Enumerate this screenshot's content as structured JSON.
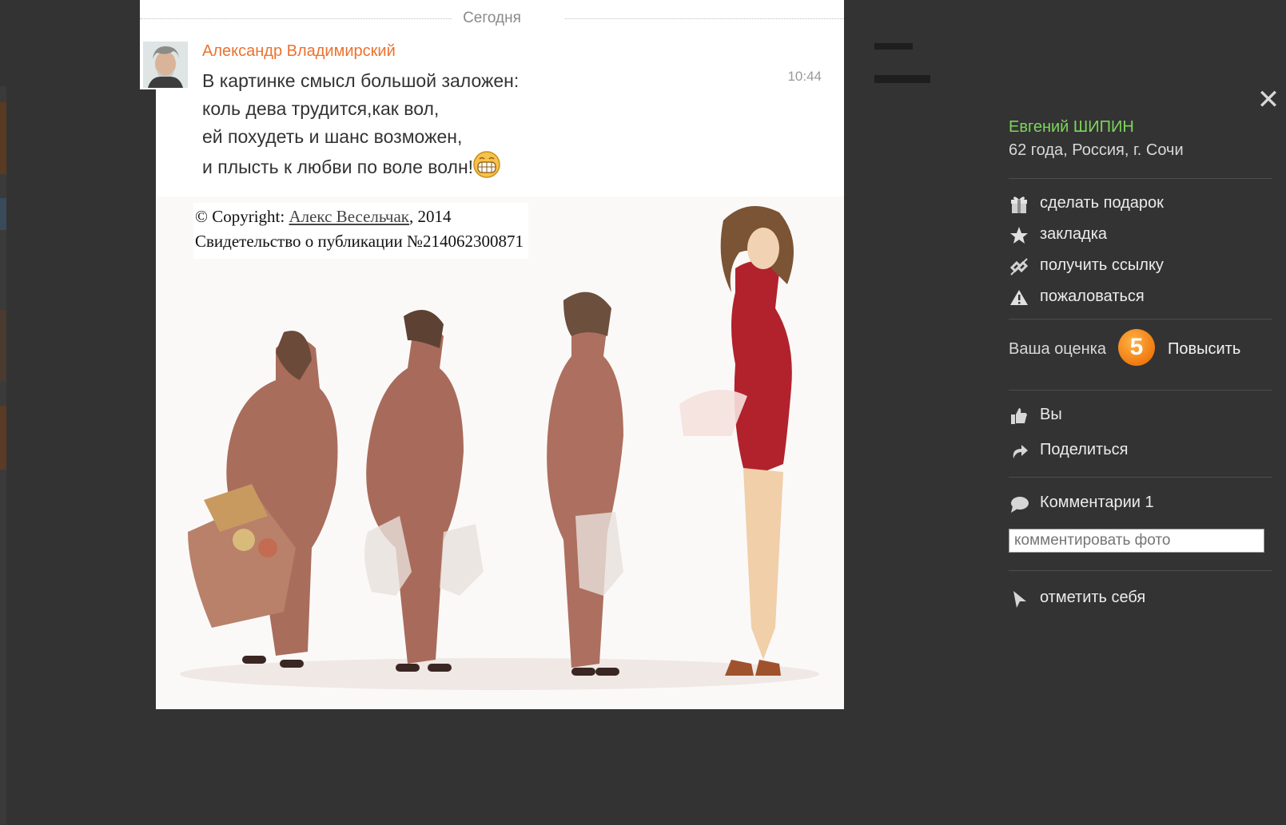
{
  "post": {
    "date_label": "Сегодня",
    "author": "Александр Владимирский",
    "time": "10:44",
    "poem_lines": [
      "В картинке смысл большой заложен:",
      "коль дева трудится,как вол,",
      "ей похудеть и шанс возможен,",
      "и плысть к любви по воле волн!"
    ],
    "copyright": {
      "prefix": "© Copyright: ",
      "author_link": "Алекс Весельчак",
      "year": ", 2014",
      "certificate": "Свидетельство о публикации №214062300871"
    }
  },
  "panel": {
    "user_name": "Евгений ШИПИН",
    "user_info": "62 года, Россия, г. Сочи",
    "actions": [
      {
        "label": "сделать подарок",
        "icon": "gift-icon"
      },
      {
        "label": "закладка",
        "icon": "star-icon"
      },
      {
        "label": "получить ссылку",
        "icon": "link-icon"
      },
      {
        "label": "пожаловаться",
        "icon": "warning-icon"
      }
    ],
    "rating": {
      "label": "Ваша оценка",
      "value": "5",
      "raise_label": "Повысить",
      "accent": "#f07a10"
    },
    "like_label": "Вы",
    "share_label": "Поделиться",
    "comments_label": "Комментарии 1",
    "comment_placeholder": "комментировать фото",
    "tag_label": "отметить себя"
  },
  "colors": {
    "author": "#eb722e",
    "user_name": "#7dd55b",
    "background": "#333333"
  }
}
